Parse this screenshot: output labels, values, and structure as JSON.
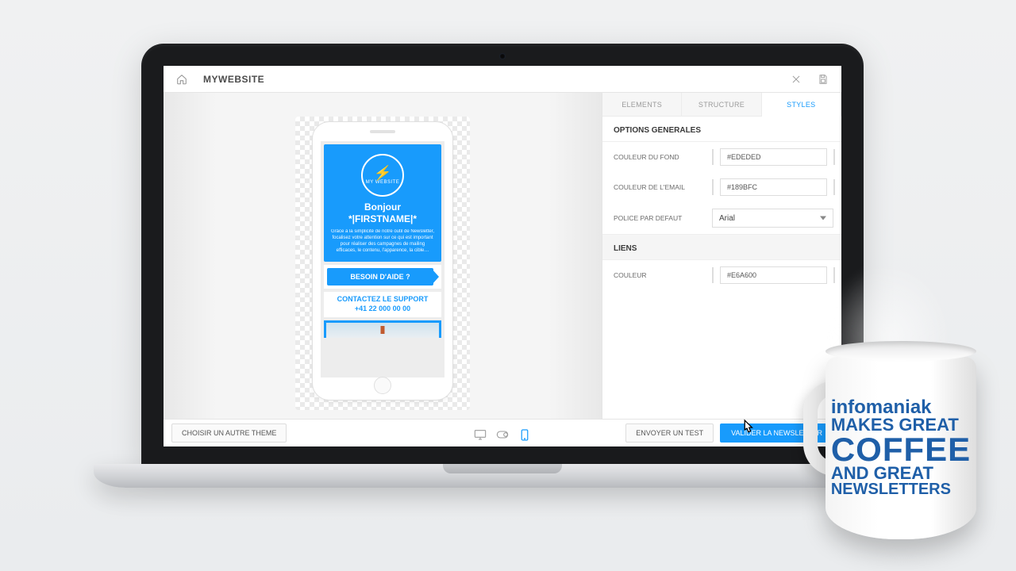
{
  "header": {
    "title": "MYWEBSITE"
  },
  "tabs": {
    "elements": "ELEMENTS",
    "structure": "STRUCTURE",
    "styles": "STYLES"
  },
  "panel": {
    "section_general": "OPTIONS GENERALES",
    "bg_label": "COULEUR DU FOND",
    "bg_value": "#EDEDED",
    "email_label": "COULEUR DE L'EMAIL",
    "email_value": "#189BFC",
    "font_label": "POLICE PAR DEFAUT",
    "font_value": "Arial",
    "section_links": "LIENS",
    "link_label": "COULEUR",
    "link_value": "#E6A600"
  },
  "colors": {
    "bg_swatch": "#ffffff",
    "email_swatch": "#189bfc",
    "link_swatch": "#d79a12"
  },
  "preview": {
    "logo_text": "MY WEBSITE",
    "hero_line1": "Bonjour",
    "hero_line2": "*|FIRSTNAME|*",
    "hero_body": "Grâce à la simplicité de notre outil de Newsletter, focalisez votre attention sur ce qui est important pour réaliser des campagnes de mailing efficaces, le contenu, l'apparence, la cible…",
    "cta": "BESOIN D'AIDE ?",
    "support_line1": "CONTACTEZ LE SUPPORT",
    "support_line2": "+41 22 000 00 00"
  },
  "footer": {
    "choose_theme": "CHOISIR UN AUTRE THEME",
    "send_test": "ENVOYER UN TEST",
    "validate": "VALIDER LA NEWSLETTER"
  },
  "mug": {
    "l1": "infomaniak",
    "l2": "MAKES GREAT",
    "l3": "COFFEE",
    "l4": "AND GREAT",
    "l5": "NEWSLETTERS"
  }
}
